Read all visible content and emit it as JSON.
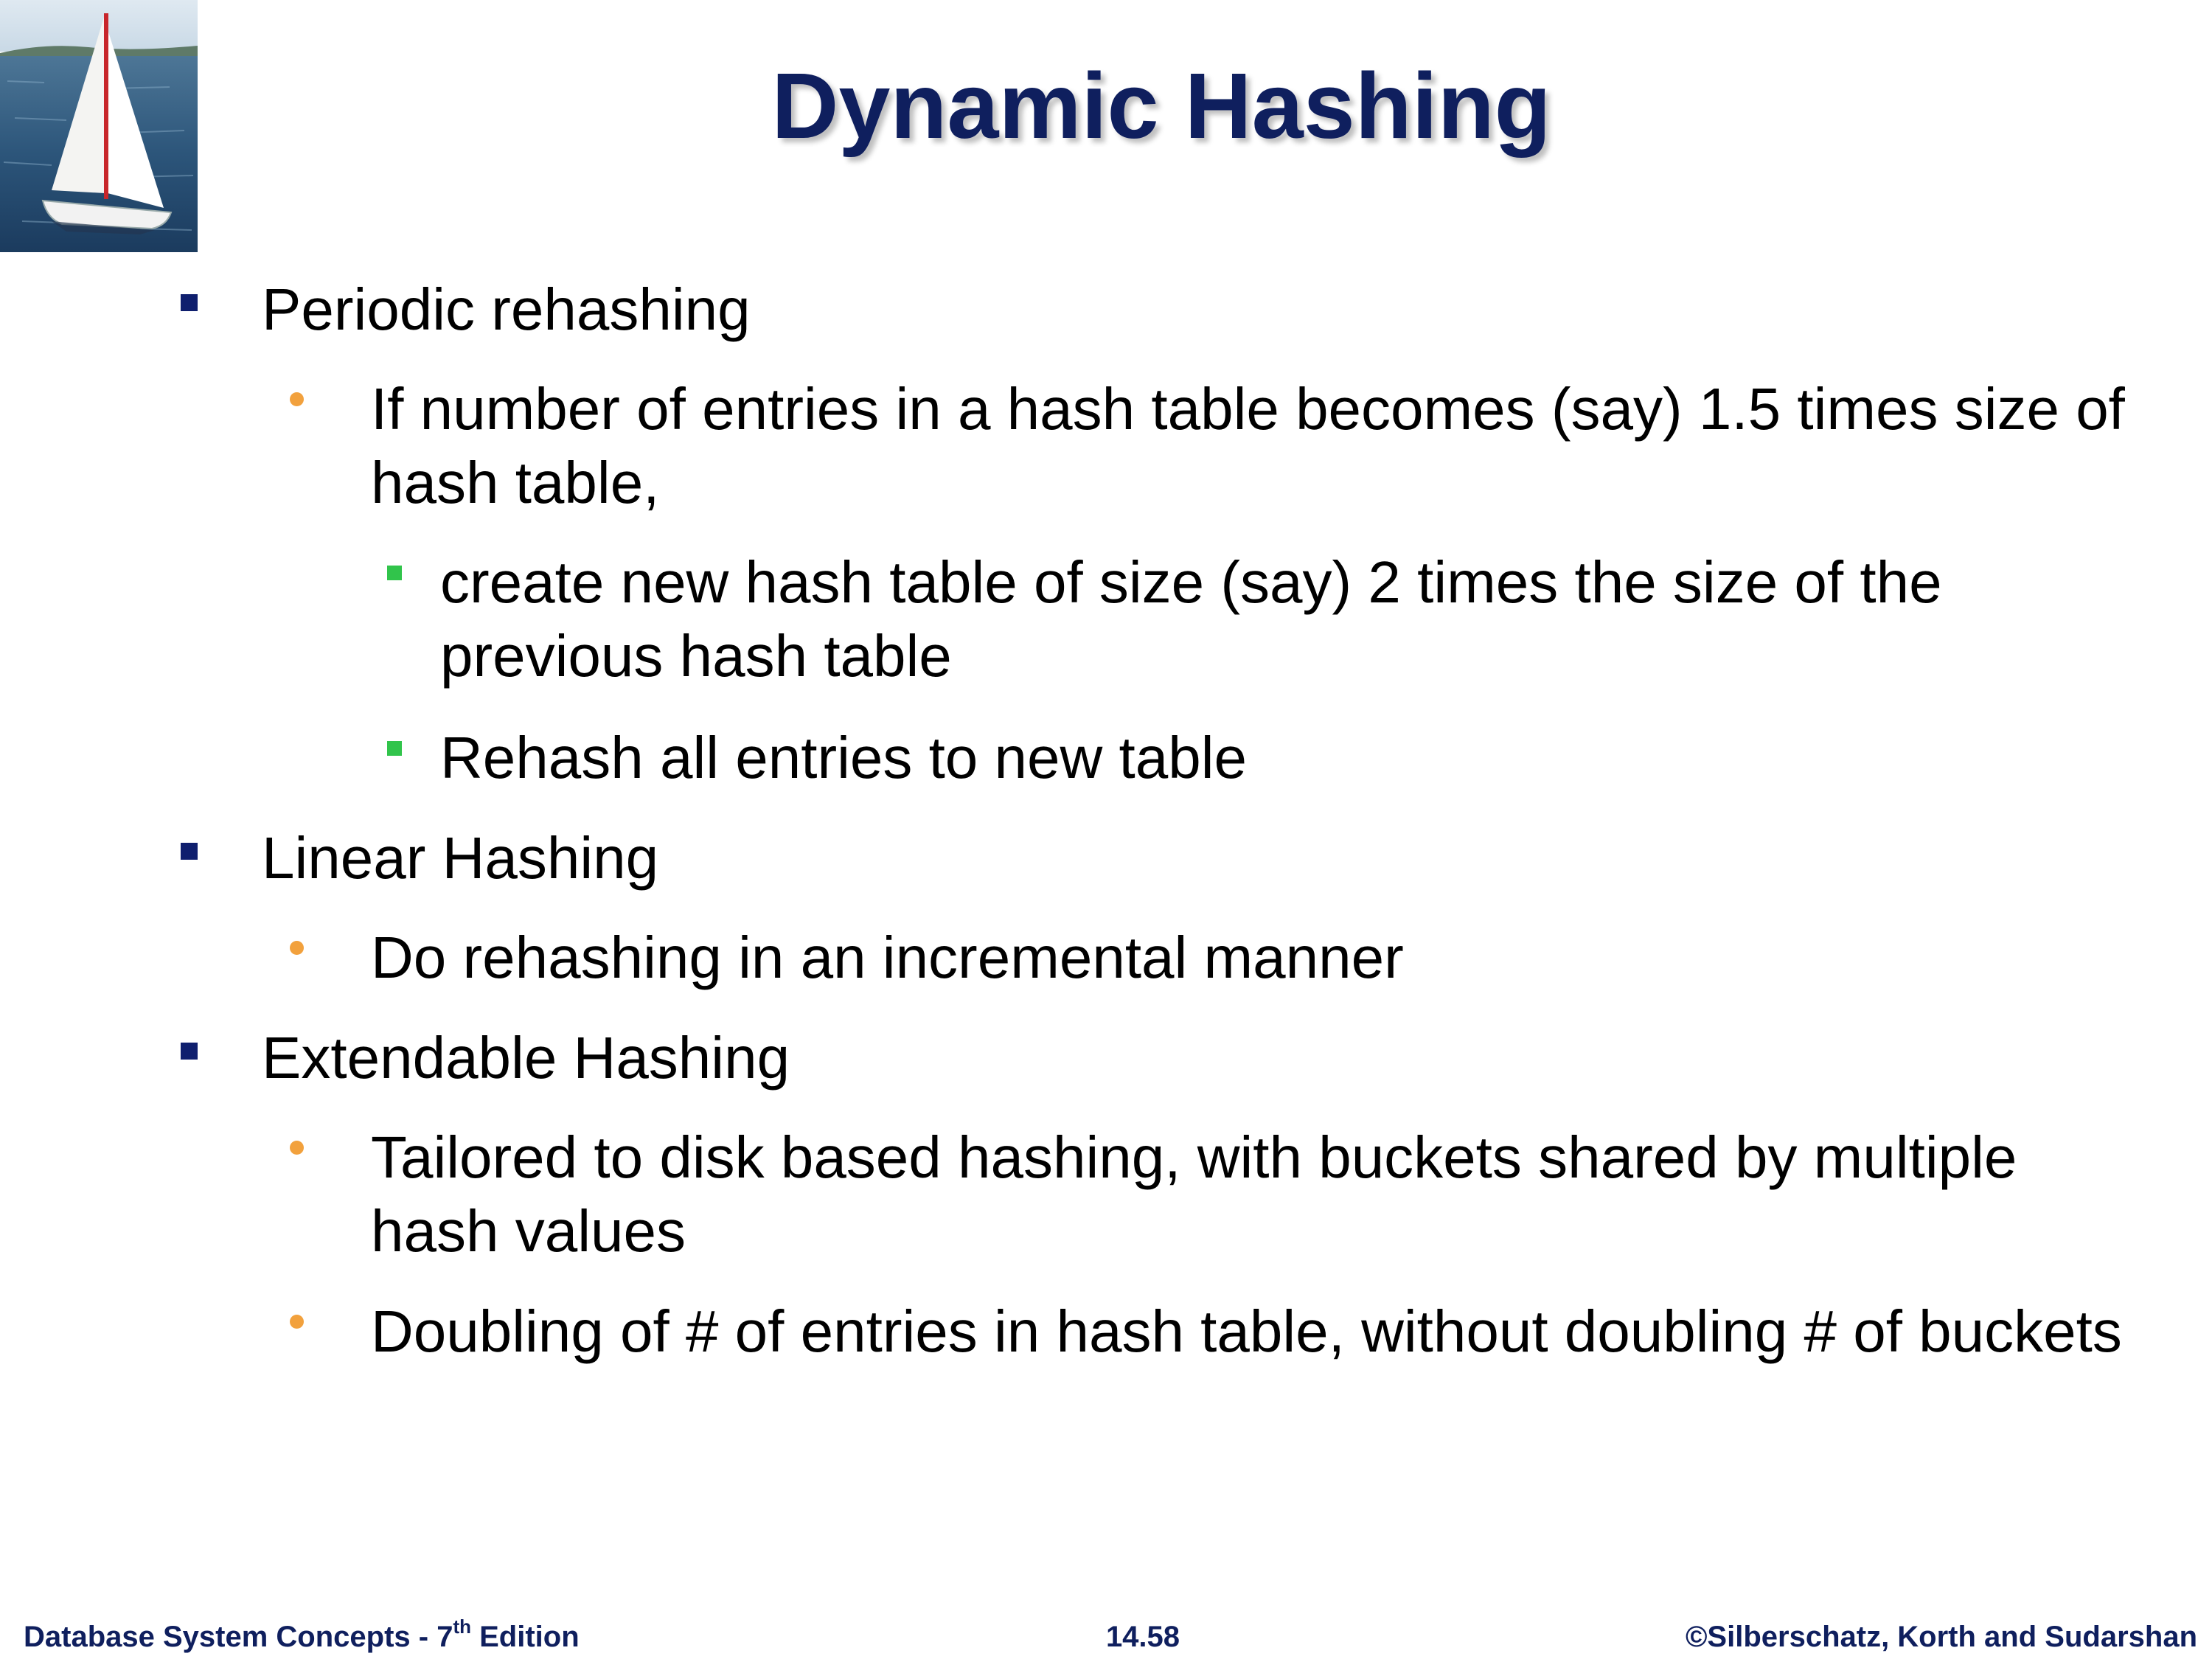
{
  "slide": {
    "title": "Dynamic Hashing",
    "corner_image": "sailboat-photo"
  },
  "bullets": [
    {
      "level": 1,
      "text": "Periodic rehashing"
    },
    {
      "level": 2,
      "text": "If number of entries in a hash table becomes (say) 1.5 times size of hash table,"
    },
    {
      "level": 3,
      "text": "create new hash table of size  (say) 2 times the size of the previous hash table"
    },
    {
      "level": 3,
      "text": "Rehash all entries to new table"
    },
    {
      "level": 1,
      "text": "Linear Hashing"
    },
    {
      "level": 2,
      "text": "Do rehashing in an incremental manner"
    },
    {
      "level": 1,
      "text": "Extendable Hashing"
    },
    {
      "level": 2,
      "text": "Tailored to disk based hashing, with buckets shared by multiple hash values"
    },
    {
      "level": 2,
      "text": "Doubling of # of entries in hash table, without doubling # of buckets"
    }
  ],
  "footer": {
    "book_prefix": "Database System Concepts - 7",
    "book_superscript": "th",
    "book_suffix": " Edition",
    "page_number": "14.58",
    "copyright": "©Silberschatz, Korth and Sudarshan"
  },
  "colors": {
    "title": "#0f1f5e",
    "level1_bullet": "#0f1f6e",
    "level2_bullet": "#f2a13d",
    "level3_bullet": "#31c44b"
  }
}
